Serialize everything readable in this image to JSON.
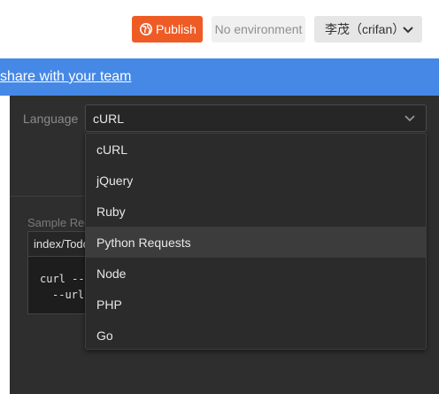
{
  "header": {
    "publish_label": "Publish",
    "environment_label": "No environment",
    "user_label": "李茂（crifan）",
    "accent_color": "#ef5b25"
  },
  "banner": {
    "link_text": "share with your team",
    "color": "#4588e6"
  },
  "language": {
    "label": "Language",
    "selected": "cURL",
    "options": [
      "cURL",
      "jQuery",
      "Ruby",
      "Python Requests",
      "Node",
      "PHP",
      "Go"
    ],
    "highlighted": "Python Requests"
  },
  "sample": {
    "label": "Sample Req",
    "tab": "index/Todo",
    "code_lines": [
      "curl --r",
      "--url "
    ]
  }
}
